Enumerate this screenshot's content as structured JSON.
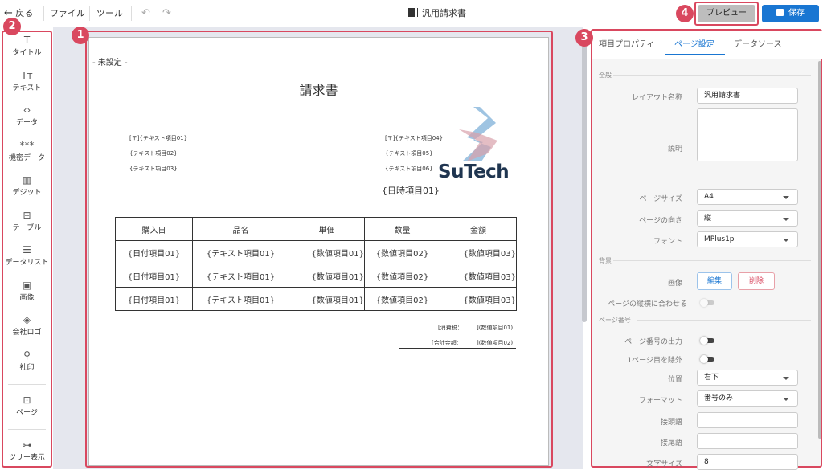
{
  "topbar": {
    "back": "戻る",
    "file": "ファイル",
    "tools": "ツール",
    "doc_title": "汎用請求書",
    "preview": "プレビュー",
    "save": "保存"
  },
  "badges": [
    "1",
    "2",
    "3",
    "4"
  ],
  "sidebar": {
    "items": [
      {
        "label": "タイトル",
        "icon": "T"
      },
      {
        "label": "テキスト",
        "icon": "Tт"
      },
      {
        "label": "データ",
        "icon": "‹›"
      },
      {
        "label": "機密データ",
        "icon": "***"
      },
      {
        "label": "デジット",
        "icon": "▥"
      },
      {
        "label": "テーブル",
        "icon": "⊞"
      },
      {
        "label": "データリスト",
        "icon": "☰"
      },
      {
        "label": "画像",
        "icon": "▣"
      },
      {
        "label": "会社ロゴ",
        "icon": "◈"
      },
      {
        "label": "社印",
        "icon": "⚲"
      },
      {
        "label": "ページ",
        "icon": "⊡"
      },
      {
        "label": "ツリー表示",
        "icon": "⊶"
      }
    ]
  },
  "paper": {
    "unset": "- 未設定 -",
    "title": "請求書",
    "left_fields": [
      "[〒]{テキスト項目01}",
      "{テキスト項目02}",
      "{テキスト項目03}"
    ],
    "right_fields": [
      "[〒]{テキスト項目04}",
      "{テキスト項目05}",
      "{テキスト項目06}"
    ],
    "logo_text": "SuTech",
    "date": "{日時項目01}",
    "table": {
      "headers": [
        "購入日",
        "品名",
        "単価",
        "数量",
        "金額"
      ],
      "rows": [
        [
          "{日付項目01}",
          "{テキスト項目01}",
          "{数値項目01}",
          "{数値項目02}",
          "{数値項目03}"
        ],
        [
          "{日付項目01}",
          "{テキスト項目01}",
          "{数値項目01}",
          "{数値項目02}",
          "{数値項目03}"
        ],
        [
          "{日付項目01}",
          "{テキスト項目01}",
          "{数値項目01}",
          "{数値項目02}",
          "{数値項目03}"
        ]
      ]
    },
    "tax_label": "[消費税：",
    "tax_value": "](数値項目01)",
    "total_label": "[合計金額：",
    "total_value": "](数値項目02)"
  },
  "panel": {
    "tabs": [
      "項目プロパティ",
      "ページ設定",
      "データソース"
    ],
    "sec_general": "全般",
    "layout_name_label": "レイアウト名称",
    "layout_name": "汎用請求書",
    "desc_label": "説明",
    "page_size_label": "ページサイズ",
    "page_size": "A4",
    "orientation_label": "ページの向き",
    "orientation": "縦",
    "font_label": "フォント",
    "font": "MPlus1p",
    "sec_bg": "背景",
    "image_label": "画像",
    "edit_btn": "編集",
    "delete_btn": "削除",
    "fit_label": "ページの縦横に合わせる",
    "sec_page_no": "ページ番号",
    "output_label": "ページ番号の出力",
    "exclude_label": "1ページ目を除外",
    "position_label": "位置",
    "position": "右下",
    "format_label": "フォーマット",
    "format": "番号のみ",
    "prefix_label": "接頭語",
    "suffix_label": "接尾語",
    "fontsize_label": "文字サイズ",
    "fontsize": "8"
  },
  "colors": {
    "accent": "#1976d2",
    "annotation": "#d9485f"
  }
}
